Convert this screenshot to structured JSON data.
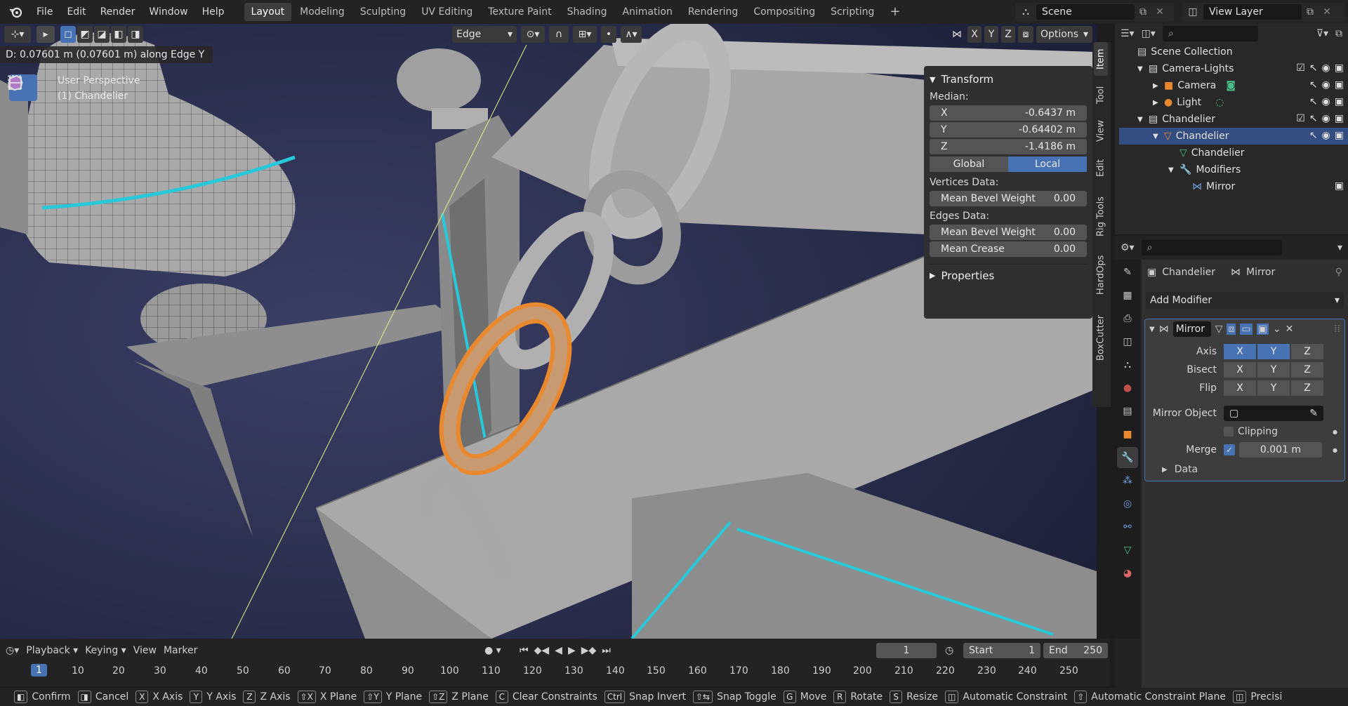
{
  "menu": [
    "File",
    "Edit",
    "Render",
    "Window",
    "Help"
  ],
  "workspaces": [
    "Layout",
    "Modeling",
    "Sculpting",
    "UV Editing",
    "Texture Paint",
    "Shading",
    "Animation",
    "Rendering",
    "Compositing",
    "Scripting"
  ],
  "active_workspace": "Layout",
  "scene": {
    "name": "Scene",
    "view_layer": "View Layer"
  },
  "viewport": {
    "select_mode": "Edge",
    "options_label": "Options",
    "axis_x": "X",
    "axis_y": "Y",
    "axis_z": "Z",
    "operation_info": "D: 0.07601 m (0.07601 m) along Edge Y",
    "perspective": "User Perspective",
    "object_label": "(1) Chandelier"
  },
  "npanel": {
    "transform_title": "Transform",
    "median_label": "Median:",
    "x_label": "X",
    "x_value": "-0.6437 m",
    "y_label": "Y",
    "y_value": "-0.64402 m",
    "z_label": "Z",
    "z_value": "-1.4186 m",
    "global_label": "Global",
    "local_label": "Local",
    "vertices_data_label": "Vertices Data:",
    "mean_bevel_weight_label": "Mean Bevel Weight",
    "v_bevel_value": "0.00",
    "edges_data_label": "Edges Data:",
    "e_bevel_value": "0.00",
    "mean_crease_label": "Mean Crease",
    "crease_value": "0.00",
    "properties_label": "Properties",
    "tabs": [
      "Item",
      "Tool",
      "View",
      "Edit",
      "Rig Tools",
      "HardOps",
      "BoxCutter"
    ]
  },
  "outliner": {
    "root": "Scene Collection",
    "items": [
      "Camera-Lights",
      "Camera",
      "Light",
      "Chandelier",
      "Chandelier",
      "Chandelier",
      "Modifiers",
      "Mirror"
    ]
  },
  "properties": {
    "object_name": "Chandelier",
    "modifier_name": "Mirror",
    "add_modifier_label": "Add Modifier",
    "mirror_title": "Mirror",
    "axis_label": "Axis",
    "bisect_label": "Bisect",
    "flip_label": "Flip",
    "axes": [
      "X",
      "Y",
      "Z"
    ],
    "mirror_object_label": "Mirror Object",
    "clipping_label": "Clipping",
    "merge_label": "Merge",
    "merge_value": "0.001 m",
    "data_label": "Data"
  },
  "timeline": {
    "playback_label": "Playback",
    "keying_label": "Keying",
    "view_label": "View",
    "marker_label": "Marker",
    "current_frame": "1",
    "start_label": "Start",
    "start_value": "1",
    "end_label": "End",
    "end_value": "250",
    "ruler_current": "1",
    "ruler": [
      "10",
      "20",
      "30",
      "40",
      "50",
      "60",
      "70",
      "80",
      "90",
      "100",
      "110",
      "120",
      "130",
      "140",
      "150",
      "160",
      "170",
      "180",
      "190",
      "200",
      "210",
      "220",
      "230",
      "240",
      "250"
    ]
  },
  "statusbar": [
    {
      "key": "",
      "label": "Confirm"
    },
    {
      "key": "",
      "label": "Cancel"
    },
    {
      "key": "X",
      "label": "X Axis"
    },
    {
      "key": "Y",
      "label": "Y Axis"
    },
    {
      "key": "Z",
      "label": "Z Axis"
    },
    {
      "key": "⇧X",
      "label": "X Plane"
    },
    {
      "key": "⇧Y",
      "label": "Y Plane"
    },
    {
      "key": "⇧Z",
      "label": "Z Plane"
    },
    {
      "key": "C",
      "label": "Clear Constraints"
    },
    {
      "key": "Ctrl",
      "label": "Snap Invert"
    },
    {
      "key": "⇧⇆",
      "label": "Snap Toggle"
    },
    {
      "key": "G",
      "label": "Move"
    },
    {
      "key": "R",
      "label": "Rotate"
    },
    {
      "key": "S",
      "label": "Resize"
    },
    {
      "key": "",
      "label": "Automatic Constraint"
    },
    {
      "key": "⇧",
      "label": "Automatic Constraint Plane"
    },
    {
      "key": "",
      "label": "Precisi"
    }
  ],
  "colors": {
    "accent": "#4772b3",
    "selection": "#e8892f",
    "edge_highlight": "#27c8d8"
  }
}
